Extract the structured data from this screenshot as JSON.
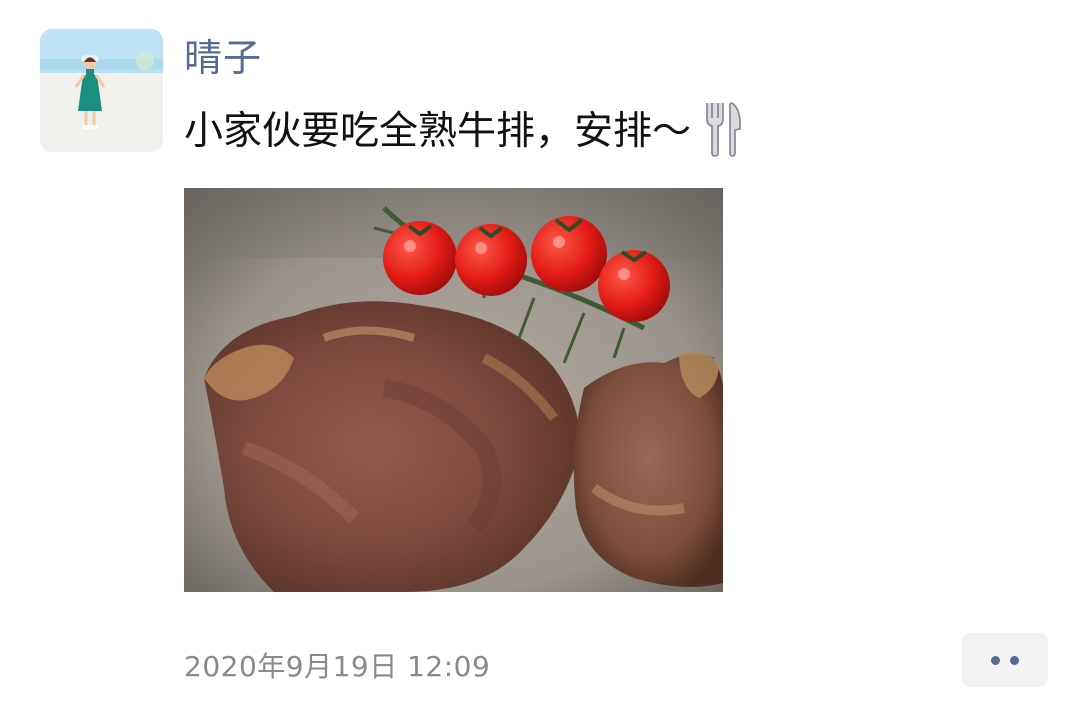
{
  "post": {
    "author_name": "晴子",
    "text": "小家伙要吃全熟牛排，安排～",
    "emoji_icon": "fork-and-knife-icon",
    "timestamp": "2020年9月19日 12:09",
    "more_icon": "more-dots-icon",
    "colors": {
      "author": "#576b95",
      "text": "#111111",
      "timestamp": "#8a8a8a",
      "more_button_bg": "#f3f3f5"
    }
  }
}
